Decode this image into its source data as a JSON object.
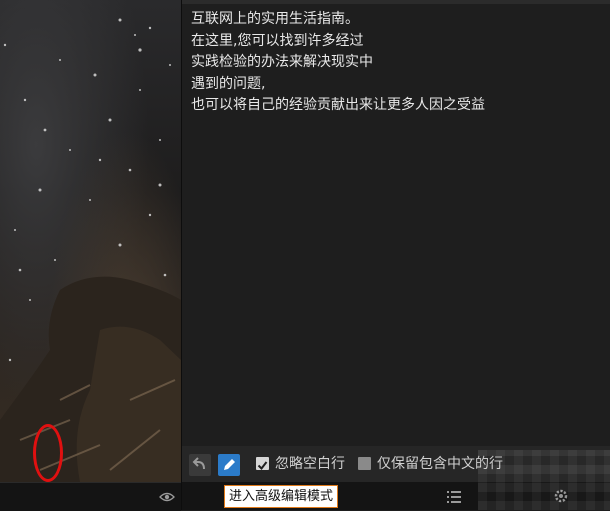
{
  "text_lines": [
    "互联网上的实用生活指南。",
    "在这里,您可以找到许多经过",
    "实践检验的办法来解决现实中",
    "遇到的问题,",
    "也可以将自己的经验贡献出来让更多人因之受益"
  ],
  "toolbar": {
    "undo_icon": "undo-icon",
    "pencil_icon": "pencil-icon",
    "ignore_blank_label": "忽略空白行",
    "ignore_blank_checked": true,
    "keep_chinese_label": "仅保留包含中文的行",
    "keep_chinese_checked": false
  },
  "bottom": {
    "tooltip": "进入高级编辑模式",
    "list_icon": "list-icon",
    "gear_icon": "gear-icon",
    "eye_icon": "eye-icon"
  },
  "colors": {
    "accent": "#2b7bc9",
    "highlight_ring": "#e01010",
    "tooltip_border": "#e07a1a"
  }
}
